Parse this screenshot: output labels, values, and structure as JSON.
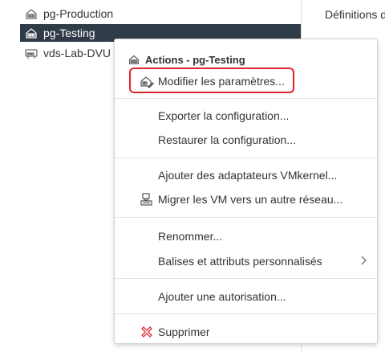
{
  "tree": {
    "items": [
      {
        "label": "pg-Production",
        "icon": "portgroup-icon"
      },
      {
        "label": "pg-Testing",
        "icon": "portgroup-icon",
        "selected": true
      },
      {
        "label": "vds-Lab-DVU",
        "icon": "switch-icon"
      }
    ]
  },
  "right_pane": {
    "title": "Définitions d"
  },
  "menu": {
    "header": "Actions - pg-Testing",
    "items": [
      {
        "label": "Modifier les paramètres...",
        "icon": "edit-settings-icon"
      },
      {
        "label": "Exporter la configuration..."
      },
      {
        "label": "Restaurer la configuration..."
      },
      {
        "label": "Ajouter des adaptateurs VMkernel..."
      },
      {
        "label": "Migrer les VM vers un autre réseau...",
        "icon": "migrate-vm-icon"
      },
      {
        "label": "Renommer..."
      },
      {
        "label": "Balises et attributs personnalisés",
        "submenu": true
      },
      {
        "label": "Ajouter une autorisation..."
      },
      {
        "label": "Supprimer",
        "icon": "delete-icon"
      }
    ]
  },
  "colors": {
    "selection": "#2f3b46",
    "highlight": "#e0242b",
    "delete": "#e0242b"
  }
}
